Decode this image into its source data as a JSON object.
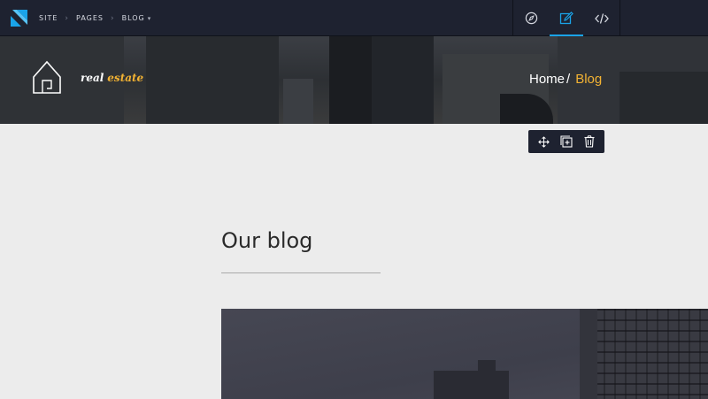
{
  "topbar": {
    "breadcrumbs": [
      "SITE",
      "PAGES",
      "BLOG"
    ],
    "modes": [
      "compass-icon",
      "edit-icon",
      "code-icon"
    ],
    "active_mode": "edit-icon",
    "accent": "#1aa3e8"
  },
  "hero": {
    "brand_word_1": "real",
    "brand_word_2": "estate",
    "crumb_home": "Home",
    "crumb_sep": "/",
    "crumb_current": "Blog",
    "accent": "#f2b233"
  },
  "floating_toolbar": {
    "icons": [
      "move-icon",
      "add-block-icon",
      "trash-icon"
    ]
  },
  "content": {
    "title": "Our blog"
  }
}
